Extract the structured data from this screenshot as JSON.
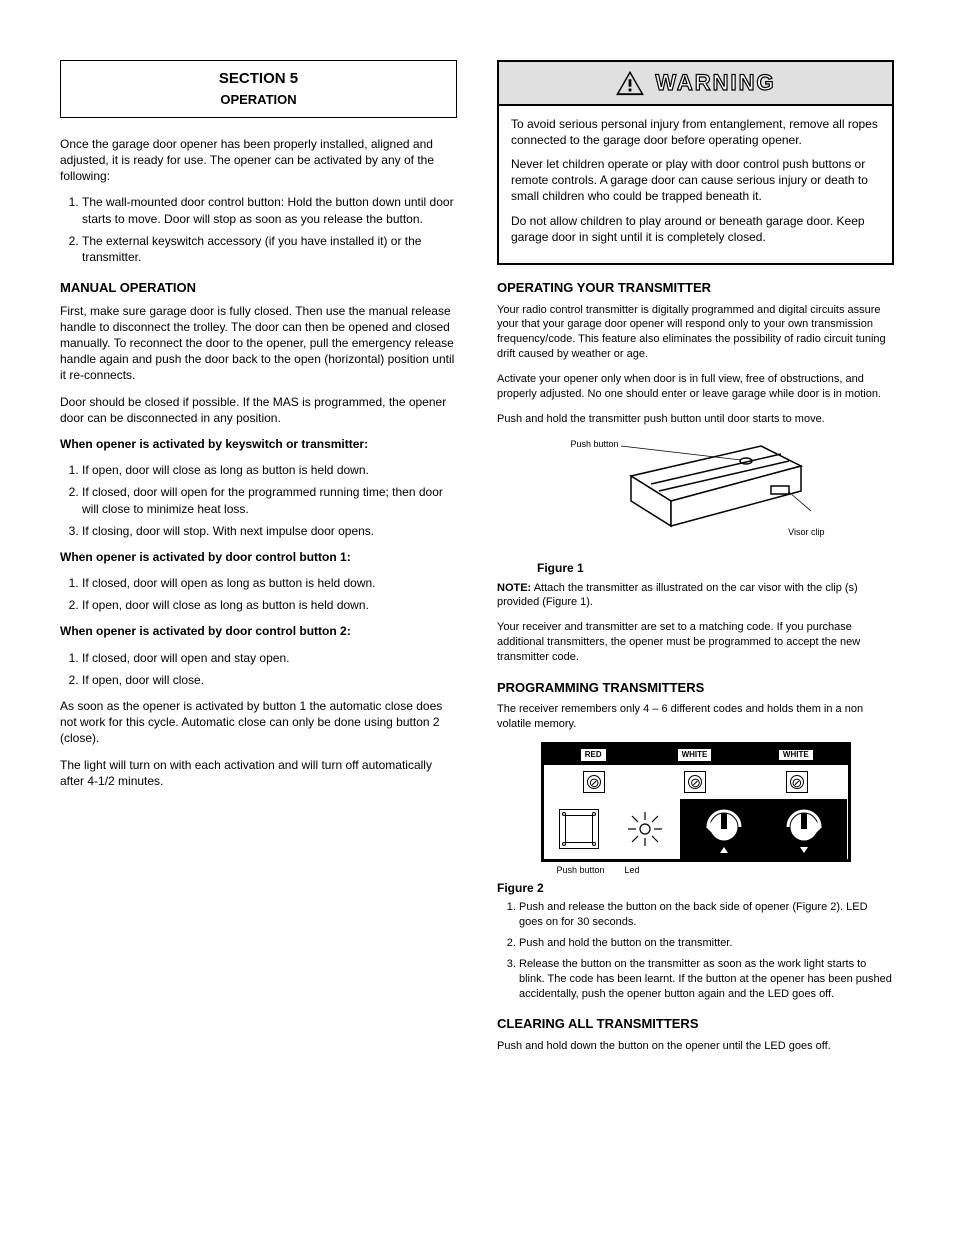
{
  "leftCol": {
    "sectionBox": {
      "title": "SECTION 5",
      "subtitle": "OPERATION"
    },
    "p1": "Once the garage door opener has been properly installed, aligned and adjusted, it is ready for use. The opener can be activated by any of the following:",
    "list1": [
      "The wall-mounted door control button: Hold the button down until door starts to move. Door will stop as soon as you release the button.",
      "The external keyswitch accessory (if you have installed it) or the transmitter."
    ],
    "subhead1": "MANUAL OPERATION",
    "p2": "First, make sure garage door is fully closed. Then use the manual release handle to disconnect the trolley. The door can then be opened and closed manually. To reconnect the door to the opener, pull the emergency release handle again and push the door back to the open (horizontal) position until it re-connects.",
    "p3": "Door should be closed if possible. If the MAS is programmed, the opener door can be disconnected in any position.",
    "bold1": "When opener is activated by keyswitch or transmitter:",
    "list2": [
      "If open, door will close as long as button is held down.",
      "If closed, door will open for the programmed running time; then door will close to minimize heat loss.",
      "If closing, door will stop. With next impulse door opens."
    ],
    "bold2": "When opener is activated by door control button 1:",
    "list3": [
      "If closed, door will open as long as button is held down.",
      "If open, door will close as long as button is held down."
    ],
    "bold3": "When opener is activated by door control button 2:",
    "list4": [
      "If closed, door will open and stay open.",
      "If open, door will close."
    ],
    "p4": "As soon as the opener is activated by button 1 the automatic close does not work for this cycle. Automatic close can only be done using button 2 (close).",
    "p5": "The light will turn on with each activation and will turn off automatically after 4-1/2 minutes."
  },
  "rightCol": {
    "warning": {
      "header": "WARNING",
      "p1": "To avoid serious personal injury from entanglement, remove all ropes connected to the garage door before operating opener.",
      "p2": "Never let children operate or play with door control push buttons or remote controls. A garage door can cause serious injury or death to small children who could be trapped beneath it.",
      "p3": "Do not allow children to play around or beneath garage door. Keep garage door in sight until it is completely closed."
    },
    "subhead_tx": "OPERATING YOUR TRANSMITTER",
    "tx_p1": "Your radio control transmitter is digitally programmed and digital circuits assure your that your garage door opener will respond only to your own transmission frequency/code. This feature also eliminates the possibility of radio circuit tuning drift caused by weather or age.",
    "tx_p2": "Activate your opener only when door is in full view, free of obstructions, and properly adjusted. No one should enter or leave garage while door is in motion.",
    "tx_p3": "Push and hold the transmitter push button until door starts to move.",
    "fig1": {
      "caption": "Figure 1",
      "callout_top": "Push button",
      "callout_right": "Visor clip"
    },
    "note_label": "NOTE:",
    "note_text": "Attach the transmitter as illustrated on the car visor with the clip (s) provided (Figure 1).",
    "tx_p4": "Your receiver and transmitter are set to a matching code. If you purchase additional transmitters, the opener must be programmed to accept the new transmitter code.",
    "subhead_prog": "PROGRAMMING TRANSMITTERS",
    "prog_p1": "The receiver remembers only 4 – 6 different codes and holds them in a non volatile memory.",
    "fig2": {
      "caption": "Figure 2",
      "callout_push": "Push button",
      "callout_led": "Led",
      "panel_red": "RED",
      "panel_white": "WHITE",
      "panel_white2": "WHITE"
    },
    "prog_ol": [
      "Push and release the button on the back side of opener (Figure 2). LED goes on for 30 seconds.",
      "Push and hold the button on the transmitter.",
      "Release the button on the transmitter as soon as the work light starts to blink. The code has been learnt. If the button at the opener has been pushed accidentally, push the opener button again and the LED goes off."
    ],
    "subhead_clear": "CLEARING ALL TRANSMITTERS",
    "clear_p": "Push and hold down the button on the opener until the LED goes off."
  }
}
